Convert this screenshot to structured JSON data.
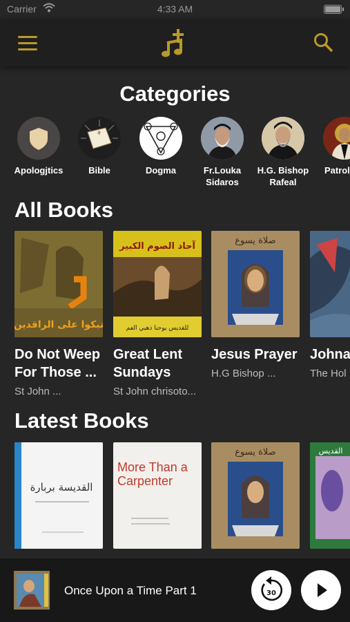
{
  "status": {
    "carrier": "Carrier",
    "time": "4:33 AM"
  },
  "header": {
    "menu_icon": "hamburger-menu-icon",
    "logo_icon": "cross-music-note-logo",
    "search_icon": "search-icon",
    "accent": "#b99a2a"
  },
  "sections": {
    "categories": "Categories",
    "all_books": "All Books",
    "latest_books": "Latest Books"
  },
  "categories": [
    {
      "label": "Apologjtics"
    },
    {
      "label": "Bible"
    },
    {
      "label": "Dogma"
    },
    {
      "label": "Fr.Louka Sidaros"
    },
    {
      "label": "H.G. Bishop Rafeal"
    },
    {
      "label": "Patrol"
    }
  ],
  "all_books": [
    {
      "title": "Do Not Weep For Those ...",
      "author": "St John ..."
    },
    {
      "title": "Great Lent Sundays",
      "author": "St John chrisoto..."
    },
    {
      "title": "Jesus Prayer",
      "author": "H.G Bishop ..."
    },
    {
      "title": "Johna",
      "author": "The Hol"
    }
  ],
  "latest_books": [
    {
      "cover_text": ""
    },
    {
      "cover_text": "More Than a Carpenter"
    },
    {
      "cover_text": ""
    },
    {
      "cover_text": ""
    }
  ],
  "player": {
    "track": "Once Upon a Time Part 1",
    "rewind_seconds": "30"
  }
}
